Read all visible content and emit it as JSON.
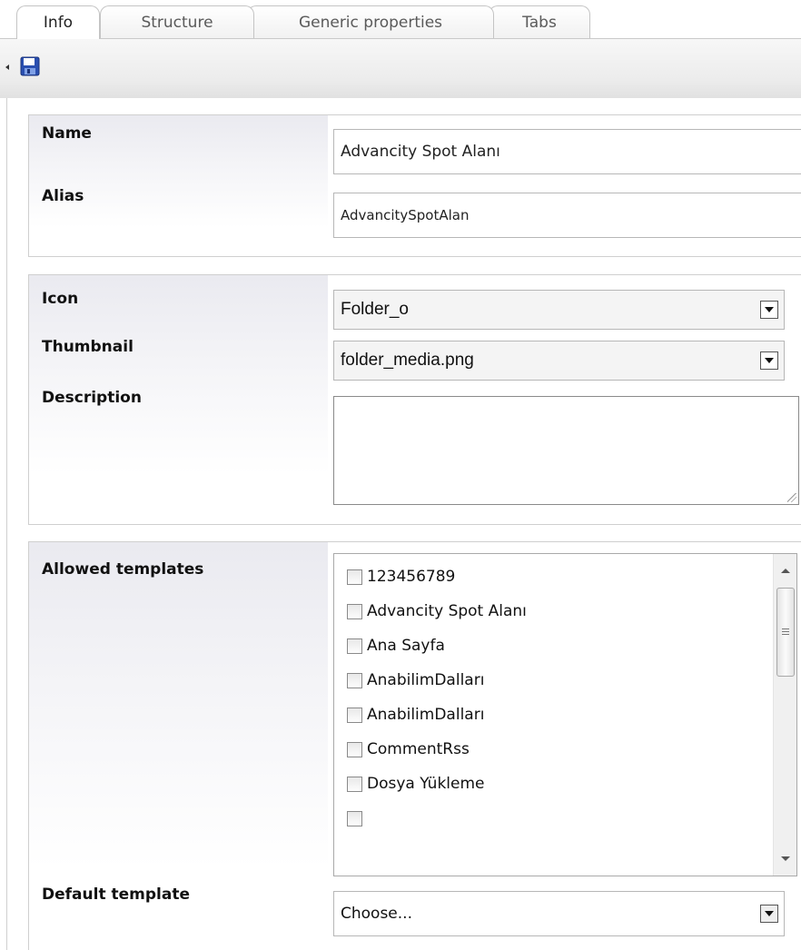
{
  "tabs": [
    {
      "label": "Info",
      "active": true
    },
    {
      "label": "Structure",
      "active": false
    },
    {
      "label": "Generic properties",
      "active": false
    },
    {
      "label": "Tabs",
      "active": false
    }
  ],
  "toolbar": {
    "save_icon": "save-disk-icon"
  },
  "info_panel": {
    "name_label": "Name",
    "name_value": "Advancity Spot Alanı",
    "alias_label": "Alias",
    "alias_value": "AdvancitySpotAlan"
  },
  "appearance_panel": {
    "icon_label": "Icon",
    "icon_value": "Folder_o",
    "thumbnail_label": "Thumbnail",
    "thumbnail_value": "folder_media.png",
    "description_label": "Description",
    "description_value": ""
  },
  "templates_panel": {
    "allowed_label": "Allowed templates",
    "templates": [
      {
        "label": "123456789",
        "checked": false
      },
      {
        "label": "Advancity Spot Alanı",
        "checked": false
      },
      {
        "label": "Ana Sayfa",
        "checked": false
      },
      {
        "label": "AnabilimDalları",
        "checked": false
      },
      {
        "label": "AnabilimDalları",
        "checked": false
      },
      {
        "label": "CommentRss",
        "checked": false
      },
      {
        "label": "Dosya Yükleme",
        "checked": false
      }
    ],
    "default_label": "Default template",
    "default_value": "Choose..."
  },
  "colors": {
    "tab_border": "#c4c4c4",
    "panel_border": "#cfcfcf",
    "save_icon_blue": "#2a4fb0"
  }
}
